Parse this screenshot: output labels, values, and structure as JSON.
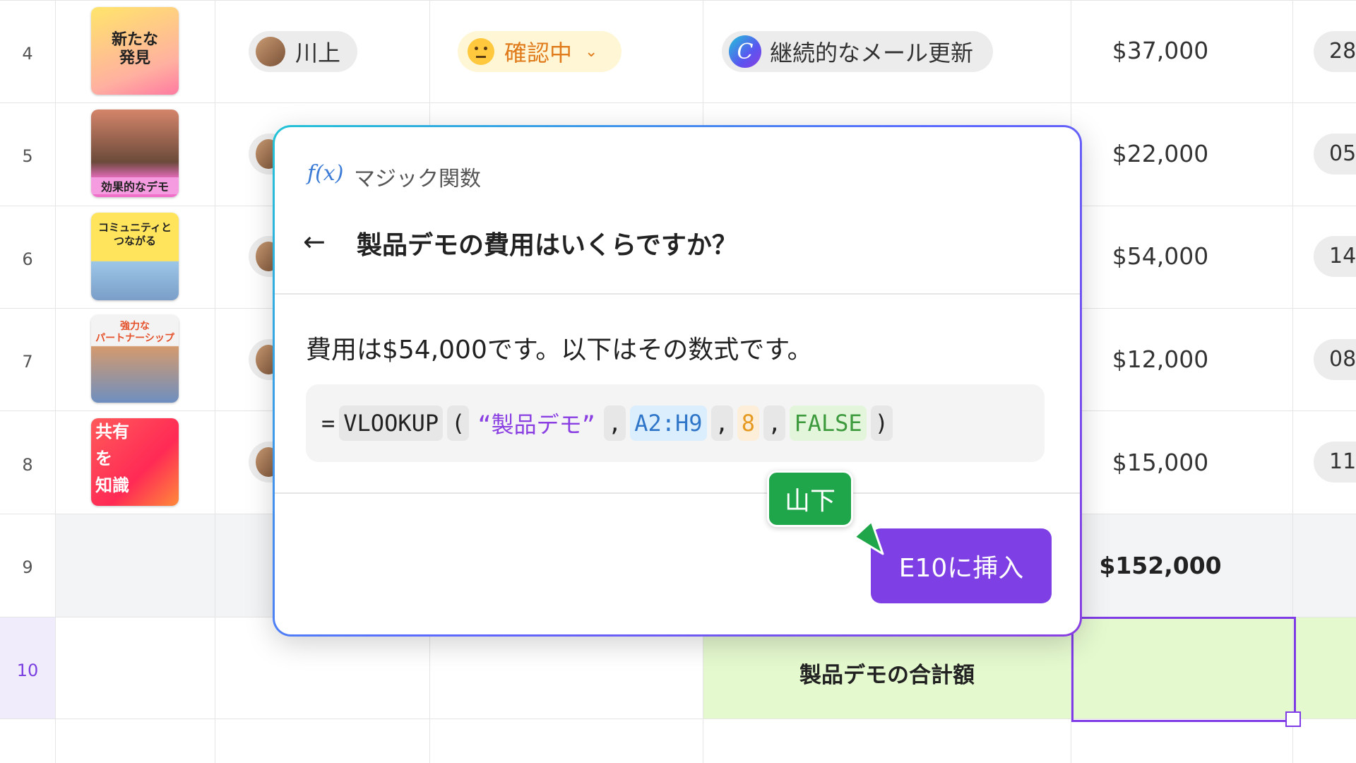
{
  "rows": [
    {
      "num": "4",
      "thumb_text": "新たな\n発見",
      "person": "川上",
      "status": "確認中",
      "campaign": "継続的なメール更新",
      "amount": "$37,000",
      "chip": "28"
    },
    {
      "num": "5",
      "thumb_text": "効果的なデモ",
      "amount": "$22,000",
      "chip": "05"
    },
    {
      "num": "6",
      "thumb_text": "コミュニティと\nつながる",
      "amount": "$54,000",
      "chip": "14"
    },
    {
      "num": "7",
      "thumb_text": "強力な\nパートナーシップ",
      "amount": "$12,000",
      "chip": "08"
    },
    {
      "num": "8",
      "thumb_text": "共有\nを\n知識",
      "amount": "$15,000",
      "chip": "11"
    },
    {
      "num": "9",
      "amount": "$152,000"
    },
    {
      "num": "10",
      "total_label": "製品デモの合計額"
    }
  ],
  "dialog": {
    "fx_icon": "f(x)",
    "title": "マジック関数",
    "back_icon": "←",
    "question": "製品デモの費用はいくらですか？",
    "answer": "費用は$54,000です。以下はその数式です。",
    "formula": {
      "eq": "=",
      "fn": "VLOOKUP",
      "open": "(",
      "str": "“製品デモ”",
      "comma1": ",",
      "range": "A2:H9",
      "comma2": ",",
      "num": "8",
      "comma3": ",",
      "bool": "FALSE",
      "close": ")"
    },
    "insert_button": "E10に挿入"
  },
  "collaborator": {
    "name": "山下",
    "color": "#1fa54a"
  },
  "icons": {
    "status_emoji": "thinking-face-icon",
    "chevron": "chevron-down-icon",
    "campaign_logo": "canva-c-icon"
  },
  "colors": {
    "accent": "#7e3fe4",
    "selection": "#7f3ce6",
    "green_cell": "#e5f9cf"
  }
}
